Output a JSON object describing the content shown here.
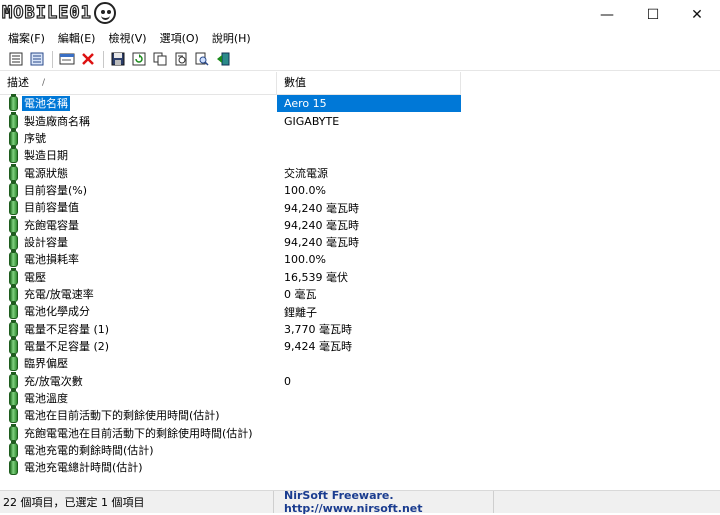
{
  "window": {
    "logo_text": "MOBILE01",
    "buttons": {
      "minimize": "—",
      "maximize": "☐",
      "close": "✕"
    }
  },
  "menu": [
    {
      "label": "檔案(F)"
    },
    {
      "label": "編輯(E)"
    },
    {
      "label": "檢視(V)"
    },
    {
      "label": "選項(O)"
    },
    {
      "label": "說明(H)"
    }
  ],
  "toolbar": [
    "details-view-icon",
    "list-view-icon",
    "properties-icon",
    "delete-icon",
    "save-icon",
    "refresh-icon",
    "copy-icon",
    "html-report-icon",
    "find-icon",
    "exit-icon"
  ],
  "columns": {
    "description": "描述",
    "value": "數值",
    "sort_indicator": "/"
  },
  "rows": [
    {
      "label": "電池名稱",
      "value": "Aero 15",
      "selected": true
    },
    {
      "label": "製造廠商名稱",
      "value": "GIGABYTE"
    },
    {
      "label": "序號",
      "value": ""
    },
    {
      "label": "製造日期",
      "value": ""
    },
    {
      "label": "電源狀態",
      "value": "交流電源"
    },
    {
      "label": "目前容量(%)",
      "value": "100.0%"
    },
    {
      "label": "目前容量值",
      "value": "94,240 毫瓦時"
    },
    {
      "label": "充飽電容量",
      "value": "94,240 毫瓦時"
    },
    {
      "label": "設計容量",
      "value": "94,240 毫瓦時"
    },
    {
      "label": "電池損耗率",
      "value": "100.0%"
    },
    {
      "label": "電壓",
      "value": "16,539 毫伏"
    },
    {
      "label": "充電/放電速率",
      "value": "0 毫瓦"
    },
    {
      "label": "電池化學成分",
      "value": "鋰離子"
    },
    {
      "label": "電量不足容量 (1)",
      "value": "3,770 毫瓦時"
    },
    {
      "label": "電量不足容量 (2)",
      "value": "9,424 毫瓦時"
    },
    {
      "label": "臨界偏壓",
      "value": ""
    },
    {
      "label": "充/放電次數",
      "value": "0"
    },
    {
      "label": "電池溫度",
      "value": ""
    },
    {
      "label": "電池在目前活動下的剩餘使用時間(估計)",
      "value": ""
    },
    {
      "label": "充飽電電池在目前活動下的剩餘使用時間(估計)",
      "value": ""
    },
    {
      "label": "電池充電的剩餘時間(估計)",
      "value": ""
    },
    {
      "label": "電池充電總計時間(估計)",
      "value": ""
    }
  ],
  "status": {
    "items": "22 個項目，已選定 1 個項目",
    "credit": "NirSoft Freeware.  http://www.nirsoft.net"
  },
  "colors": {
    "selection": "#0078d7",
    "status_link": "#1a3c8f",
    "battery_green": "#2f8a2f"
  }
}
